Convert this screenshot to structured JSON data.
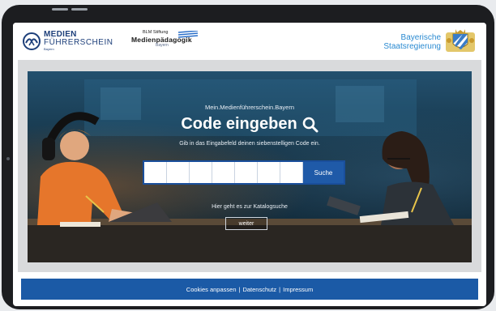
{
  "header": {
    "mf_logo": {
      "line1": "MEDIEN",
      "line2": "FÜHRERSCHEIN",
      "line3": "Bayern"
    },
    "blm_logo": {
      "line1": "BLM Stiftung",
      "line2": "Medienpädagogik",
      "line3": "Bayern"
    },
    "gov_logo": {
      "line1": "Bayerische",
      "line2": "Staatsregierung"
    }
  },
  "hero": {
    "site_name": "Mein.Medienführerschein.Bayern",
    "title": "Code eingeben",
    "description": "Gib in das Eingabefeld deinen siebenstelligen Code ein.",
    "code_boxes": 7,
    "search_label": "Suche",
    "catalog_text": "Hier geht es zur Katalogsuche",
    "weiter_label": "weiter"
  },
  "footer": {
    "cookies": "Cookies anpassen",
    "sep": "|",
    "privacy": "Datenschutz",
    "imprint": "Impressum"
  },
  "colors": {
    "brand_blue": "#1b5aa6",
    "gov_blue": "#2a8ad1"
  },
  "icons": [
    "search-icon",
    "medienfuehrerschein-logo-icon",
    "bavarian-coat-of-arms-icon"
  ]
}
